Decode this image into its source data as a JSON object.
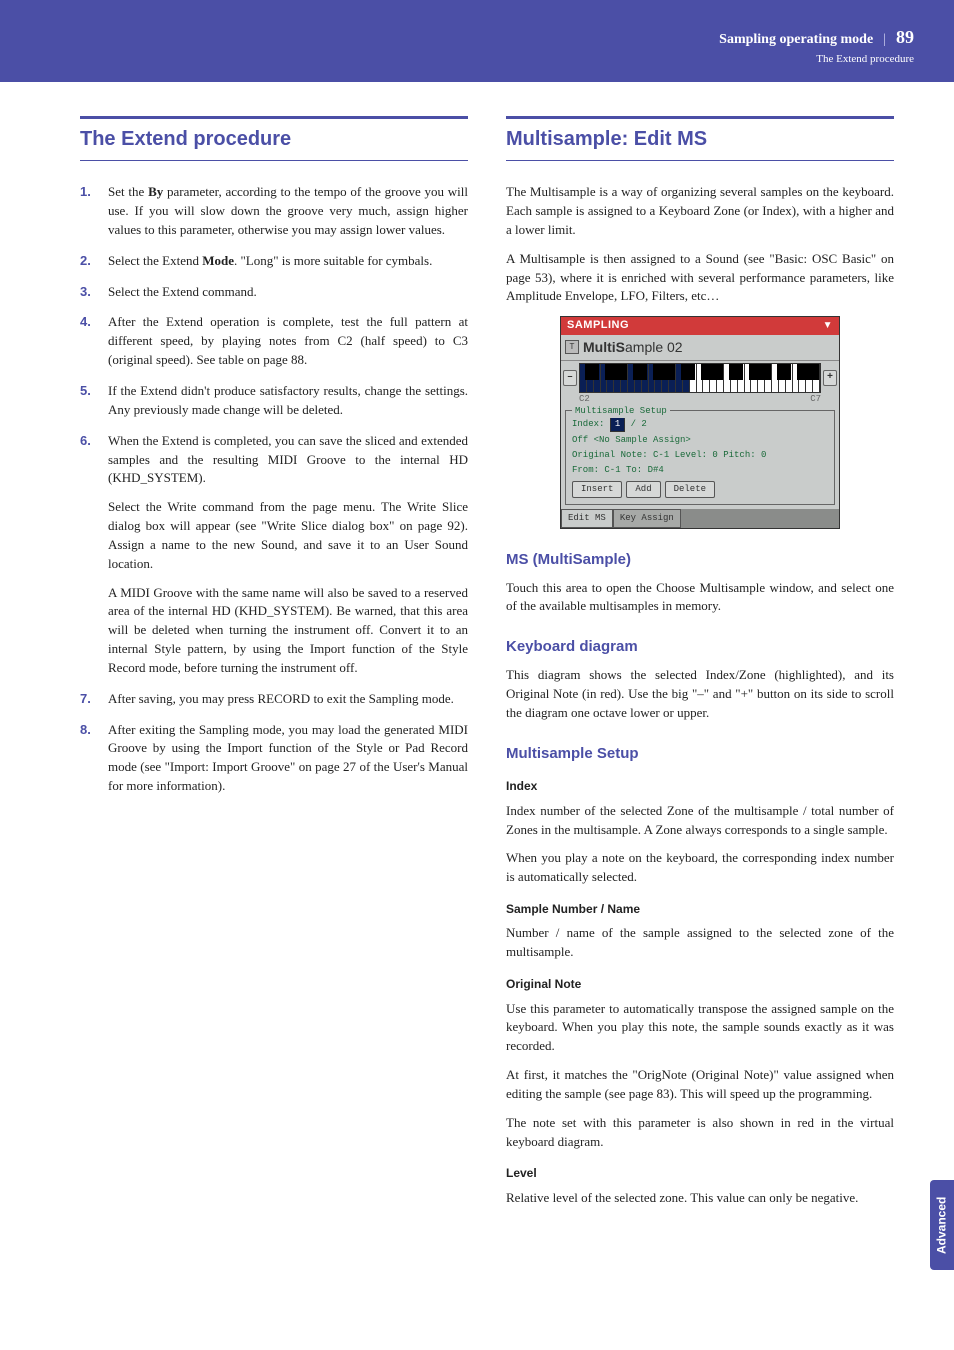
{
  "header": {
    "section": "Sampling operating mode",
    "subtitle": "The Extend procedure",
    "page": "89"
  },
  "side_tab": "Advanced",
  "left": {
    "title": "The Extend procedure",
    "steps": [
      {
        "n": "1.",
        "paras": [
          "Set the <b>By</b> parameter, according to the tempo of the groove you will use. If you will slow down the groove very much, assign higher values to this parameter, otherwise you may assign lower values."
        ]
      },
      {
        "n": "2.",
        "paras": [
          "Select the Extend <b>Mode</b>. \"Long\" is more suitable for cymbals."
        ]
      },
      {
        "n": "3.",
        "paras": [
          "Select the Extend command."
        ]
      },
      {
        "n": "4.",
        "paras": [
          "After the Extend operation is complete, test the full pattern at different speed, by playing notes from C2 (half speed) to C3 (original speed). See table on page 88."
        ]
      },
      {
        "n": "5.",
        "paras": [
          "If the Extend didn't produce satisfactory results, change the settings. Any previously made change will be deleted."
        ]
      },
      {
        "n": "6.",
        "paras": [
          "When the Extend is completed, you can save the sliced and extended samples and the resulting MIDI Groove to the internal HD (KHD_SYSTEM).",
          "Select the Write command from the page menu. The Write Slice dialog box will appear (see \"Write Slice dialog box\" on page 92). Assign a name to the new Sound, and save it to an User Sound location.",
          "A MIDI Groove with the same name will also be saved to a reserved area of the internal HD (KHD_SYSTEM). Be warned, that this area will be deleted when turning the instrument off. Convert it to an internal Style pattern, by using the Import function of the Style Record mode, before turning the instrument off."
        ]
      },
      {
        "n": "7.",
        "paras": [
          "After saving, you may press RECORD to exit the Sampling mode."
        ]
      },
      {
        "n": "8.",
        "paras": [
          "After exiting the Sampling mode, you may load the generated MIDI Groove by using the Import function of the Style or Pad Record mode (see \"Import: Import Groove\" on page 27 of the User's Manual for more information)."
        ]
      }
    ]
  },
  "right": {
    "title": "Multisample: Edit MS",
    "intro": [
      "The Multisample is a way of organizing several samples on the keyboard. Each sample is assigned to a Keyboard Zone (or Index), with a higher and a lower limit.",
      "A Multisample is then assigned to a Sound (see \"Basic: OSC Basic\" on page 53), where it is enriched with several performance parameters, like Amplitude Envelope, LFO, Filters, etc…"
    ],
    "screenshot": {
      "topbar": "SAMPLING",
      "ms_name": "MultiSample 02",
      "btn_minus": "–",
      "btn_plus": "+",
      "oct_left": "C2",
      "oct_right": "C7",
      "group_label": "Multisample Setup",
      "index_label": "Index:",
      "index_val": "1",
      "index_total": "/ 2",
      "sample_assign": "Off   <No Sample Assign>",
      "orig_note": "Original Note: C-1    Level: 0      Pitch: 0",
      "from_to": "From:  C-1   To:  D#4",
      "btn_insert": "Insert",
      "btn_add": "Add",
      "btn_delete": "Delete",
      "tab_edit": "Edit MS",
      "tab_key": "Key Assign"
    },
    "sections": [
      {
        "h2": "MS (MultiSample)",
        "paras": [
          "Touch this area to open the Choose Multisample window, and select one of the available multisamples in memory."
        ]
      },
      {
        "h2": "Keyboard diagram",
        "paras": [
          "This diagram shows the selected Index/Zone (highlighted), and its Original Note (in red). Use the big \"–\" and \"+\" button on its side to scroll the diagram one octave lower or upper."
        ]
      },
      {
        "h2": "Multisample Setup",
        "subs": [
          {
            "h3": "Index",
            "paras": [
              "Index number of the selected Zone of the multisample / total number of Zones in the multisample. A Zone always corresponds to a single sample.",
              "When you play a note on the keyboard, the corresponding index number is automatically selected."
            ]
          },
          {
            "h3": "Sample Number / Name",
            "paras": [
              "Number / name of the sample assigned to the selected zone of the multisample."
            ]
          },
          {
            "h3": "Original Note",
            "paras": [
              "Use this parameter to automatically transpose the assigned sample on the keyboard. When you play this note, the sample sounds exactly as it was recorded.",
              "At first, it matches the \"OrigNote (Original Note)\" value assigned when editing the sample (see page 83). This will speed up the programming.",
              "The note set with this parameter is also shown in red in the virtual keyboard diagram."
            ]
          },
          {
            "h3": "Level",
            "paras": [
              "Relative level of the selected zone. This value can only be negative."
            ]
          }
        ]
      }
    ]
  }
}
